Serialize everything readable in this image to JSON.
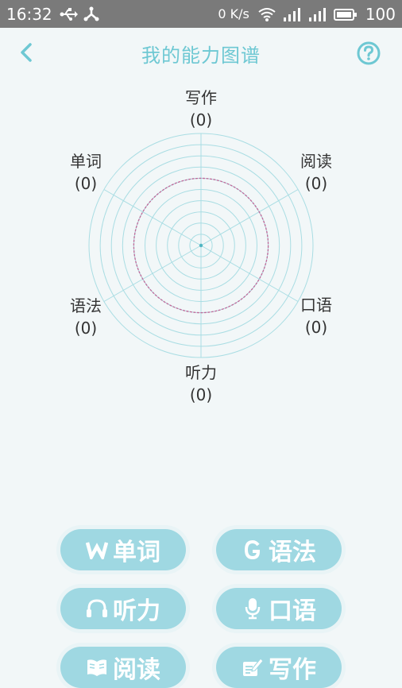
{
  "status_bar": {
    "time": "16:32",
    "net_speed": "0 K/s",
    "battery": "100",
    "icons": [
      "usb-icon",
      "share-icon",
      "wifi-icon",
      "signal-icon",
      "3g-signal-icon",
      "battery-icon"
    ]
  },
  "header": {
    "title": "我的能力图谱",
    "back_icon": "back-chevron-icon",
    "help_icon": "help-icon",
    "accent_color": "#6EC8D3"
  },
  "radar": {
    "skills": [
      {
        "name": "写作",
        "score": "(0)"
      },
      {
        "name": "阅读",
        "score": "(0)"
      },
      {
        "name": "口语",
        "score": "(0)"
      },
      {
        "name": "听力",
        "score": "(0)"
      },
      {
        "name": "语法",
        "score": "(0)"
      },
      {
        "name": "单词",
        "score": "(0)"
      }
    ],
    "grid_color": "#A9DDE3",
    "highlight_ring_color": "#C06A9A",
    "ring_count": 10
  },
  "buttons": [
    {
      "label": "单词",
      "icon": "w-icon"
    },
    {
      "label": "语法",
      "icon": "g-icon"
    },
    {
      "label": "听力",
      "icon": "headphones-icon"
    },
    {
      "label": "口语",
      "icon": "microphone-icon"
    },
    {
      "label": "阅读",
      "icon": "book-icon"
    },
    {
      "label": "写作",
      "icon": "pencil-note-icon"
    }
  ],
  "button_color": "#9FD8E2"
}
